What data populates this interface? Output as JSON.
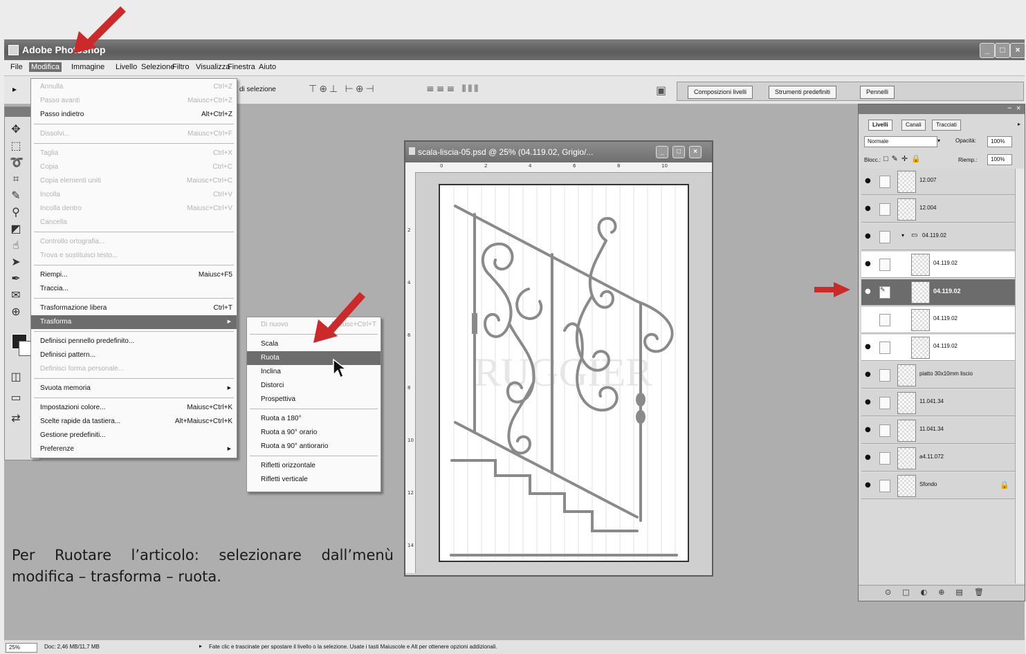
{
  "app": {
    "title": "Adobe Photoshop"
  },
  "menubar": [
    "File",
    "Modifica",
    "Immagine",
    "Livello",
    "Selezione",
    "Filtro",
    "Visualizza",
    "Finestra",
    "Aiuto"
  ],
  "options_bar": {
    "selection_label": "di selezione",
    "tabs": [
      "Composizioni livelli",
      "Strumenti predefiniti",
      "Pennelli"
    ]
  },
  "edit_menu": [
    {
      "label": "Annulla",
      "shortcut": "Ctrl+Z",
      "disabled": true
    },
    {
      "label": "Passo avanti",
      "shortcut": "Maiusc+Ctrl+Z",
      "disabled": true
    },
    {
      "label": "Passo indietro",
      "shortcut": "Alt+Ctrl+Z",
      "disabled": false
    },
    {
      "label": "Dissolvi...",
      "shortcut": "Maiusc+Ctrl+F",
      "disabled": true
    },
    {
      "label": "Taglia",
      "shortcut": "Ctrl+X",
      "disabled": true
    },
    {
      "label": "Copia",
      "shortcut": "Ctrl+C",
      "disabled": true
    },
    {
      "label": "Copia elementi uniti",
      "shortcut": "Maiusc+Ctrl+C",
      "disabled": true
    },
    {
      "label": "Incolla",
      "shortcut": "Ctrl+V",
      "disabled": true
    },
    {
      "label": "Incolla dentro",
      "shortcut": "Maiusc+Ctrl+V",
      "disabled": true
    },
    {
      "label": "Cancella",
      "shortcut": "",
      "disabled": true
    },
    {
      "label": "Controllo ortografia...",
      "shortcut": "",
      "disabled": true
    },
    {
      "label": "Trova e sostituisci testo...",
      "shortcut": "",
      "disabled": true
    },
    {
      "label": "Riempi...",
      "shortcut": "Maiusc+F5",
      "disabled": false
    },
    {
      "label": "Traccia...",
      "shortcut": "",
      "disabled": false
    },
    {
      "label": "Trasformazione libera",
      "shortcut": "Ctrl+T",
      "disabled": false
    },
    {
      "label": "Trasforma",
      "shortcut": "",
      "disabled": false,
      "highlighted": true,
      "submenu": true
    },
    {
      "label": "Definisci pennello predefinito...",
      "shortcut": "",
      "disabled": false
    },
    {
      "label": "Definisci pattern...",
      "shortcut": "",
      "disabled": false
    },
    {
      "label": "Definisci forma personale...",
      "shortcut": "",
      "disabled": true
    },
    {
      "label": "Svuota memoria",
      "shortcut": "",
      "disabled": false,
      "submenu": true
    },
    {
      "label": "Impostazioni colore...",
      "shortcut": "Maiusc+Ctrl+K",
      "disabled": false
    },
    {
      "label": "Scelte rapide da tastiera...",
      "shortcut": "Alt+Maiusc+Ctrl+K",
      "disabled": false
    },
    {
      "label": "Gestione predefiniti...",
      "shortcut": "",
      "disabled": false
    },
    {
      "label": "Preferenze",
      "shortcut": "",
      "disabled": false,
      "submenu": true
    }
  ],
  "transform_menu": [
    {
      "label": "Di nuovo",
      "shortcut": "Maiusc+Ctrl+T",
      "disabled": true
    },
    {
      "label": "Scala",
      "disabled": false
    },
    {
      "label": "Ruota",
      "disabled": false,
      "highlighted": true
    },
    {
      "label": "Inclina",
      "disabled": false
    },
    {
      "label": "Distorci",
      "disabled": false
    },
    {
      "label": "Prospettiva",
      "disabled": false
    },
    {
      "label": "Ruota a 180°",
      "disabled": false
    },
    {
      "label": "Ruota a 90° orario",
      "disabled": false
    },
    {
      "label": "Ruota a 90° antiorario",
      "disabled": false
    },
    {
      "label": "Rifletti orizzontale",
      "disabled": false
    },
    {
      "label": "Rifletti verticale",
      "disabled": false
    }
  ],
  "document": {
    "title": "scala-liscia-05.psd @ 25% (04.119.02, Grigio/...",
    "watermark": "RUGGIER",
    "ruler_top": [
      "0",
      "2",
      "4",
      "6",
      "8",
      "10"
    ],
    "ruler_left": [
      "2",
      "4",
      "6",
      "8",
      "10",
      "12",
      "14"
    ]
  },
  "layers_panel": {
    "tabs": [
      "Livelli",
      "Canali",
      "Tracciati"
    ],
    "blend_mode": "Normale",
    "opacity_label": "Opacità:",
    "opacity_value": "100%",
    "lock_label": "Blocc.:",
    "fill_label": "Riemp.:",
    "fill_value": "100%",
    "layers": [
      {
        "name": "12.007",
        "visible": true,
        "style": "grey",
        "indent": false
      },
      {
        "name": "12.004",
        "visible": true,
        "style": "grey",
        "indent": false
      },
      {
        "name": "04.119.02",
        "visible": true,
        "style": "group",
        "indent": false
      },
      {
        "name": "04.119.02",
        "visible": true,
        "style": "white",
        "indent": true
      },
      {
        "name": "04.119.02",
        "visible": true,
        "style": "selected",
        "indent": true
      },
      {
        "name": "04.119.02",
        "visible": false,
        "style": "white",
        "indent": true
      },
      {
        "name": "04.119.02",
        "visible": true,
        "style": "white",
        "indent": true
      },
      {
        "name": "piatto 30x10mm liscio",
        "visible": true,
        "style": "grey",
        "indent": false
      },
      {
        "name": "11.041.34",
        "visible": true,
        "style": "grey",
        "indent": false
      },
      {
        "name": "11.041.34",
        "visible": true,
        "style": "grey",
        "indent": false
      },
      {
        "name": "a4.11.072",
        "visible": true,
        "style": "grey",
        "indent": false
      },
      {
        "name": "Sfondo",
        "visible": true,
        "style": "grey",
        "indent": false,
        "locked": true
      }
    ]
  },
  "status_bar": {
    "zoom": "25%",
    "doc_size": "Doc: 2,46 MB/11,7 MB",
    "hint": "Fate clic e trascinate per spostare il livello o la selezione. Usate i tasti Maiuscole e Alt per ottenere opzioni addizionali."
  },
  "caption": "Per Ruotare l’articolo: selezionare dall’menù modifica – trasforma – ruota.",
  "colors": {
    "arrow": "#cc2a2a",
    "highlight": "#6d6d6d"
  }
}
